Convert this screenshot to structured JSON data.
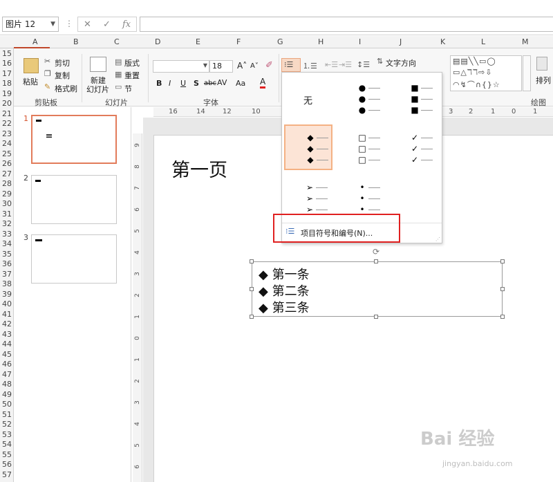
{
  "formula_bar": {
    "name_box": "图片 12",
    "fx": "fx",
    "cancel": "✕",
    "enter": "✓"
  },
  "columns": [
    "A",
    "B",
    "C",
    "D",
    "E",
    "F",
    "G",
    "H",
    "I",
    "J",
    "K",
    "L",
    "M"
  ],
  "rows": [
    "15",
    "16",
    "17",
    "18",
    "19",
    "20",
    "21",
    "22",
    "23",
    "24",
    "25",
    "26",
    "27",
    "28",
    "29",
    "30",
    "31",
    "32",
    "33",
    "34",
    "35",
    "36",
    "37",
    "38",
    "39",
    "40",
    "41",
    "42",
    "43",
    "44",
    "45",
    "46",
    "47",
    "48",
    "49",
    "50",
    "51",
    "52",
    "53",
    "54",
    "55",
    "56",
    "57"
  ],
  "ribbon": {
    "clipboard": {
      "paste": "粘贴",
      "cut": "剪切",
      "copy": "复制",
      "format_painter": "格式刷",
      "group": "剪贴板"
    },
    "slides": {
      "new_slide_line1": "新建",
      "new_slide_line2": "幻灯片",
      "layout": "版式",
      "reset": "重置",
      "section": "节",
      "group": "幻灯片"
    },
    "font": {
      "font_size": "18",
      "bold": "B",
      "italic": "I",
      "underline": "U",
      "shadow": "S",
      "strikethrough": "abc",
      "spacing": "AV",
      "case": "Aa",
      "color": "A",
      "group": "字体"
    },
    "paragraph": {
      "text_direction": "文字方向"
    },
    "drawing": {
      "arrange": "排列",
      "group": "绘图"
    }
  },
  "slides": [
    {
      "num": "1"
    },
    {
      "num": "2"
    },
    {
      "num": "3"
    }
  ],
  "ruler_h": [
    "16",
    "14",
    "12",
    "10",
    "3",
    "2",
    "1",
    "0",
    "1"
  ],
  "ruler_v": [
    "9",
    "8",
    "7",
    "6",
    "5",
    "4",
    "3",
    "2",
    "1",
    "0",
    "1",
    "2",
    "3",
    "4",
    "5",
    "6"
  ],
  "slide": {
    "title": "第一页",
    "items": [
      "第一条",
      "第二条",
      "第三条"
    ],
    "bullet": "◆"
  },
  "bullet_menu": {
    "none_label": "无",
    "options": [
      {
        "name": "none",
        "glyph": ""
      },
      {
        "name": "filled-round",
        "glyph": "●"
      },
      {
        "name": "filled-square",
        "glyph": "■"
      },
      {
        "name": "diamond",
        "glyph": "◆"
      },
      {
        "name": "hollow-square",
        "glyph": "□"
      },
      {
        "name": "checkmark",
        "glyph": "✓"
      },
      {
        "name": "arrow",
        "glyph": "➢"
      },
      {
        "name": "small-dot",
        "glyph": "•"
      }
    ],
    "footer": "项目符号和编号(N)..."
  },
  "watermark": {
    "logo": "Bai 经验",
    "url": "jingyan.baidu.com"
  }
}
